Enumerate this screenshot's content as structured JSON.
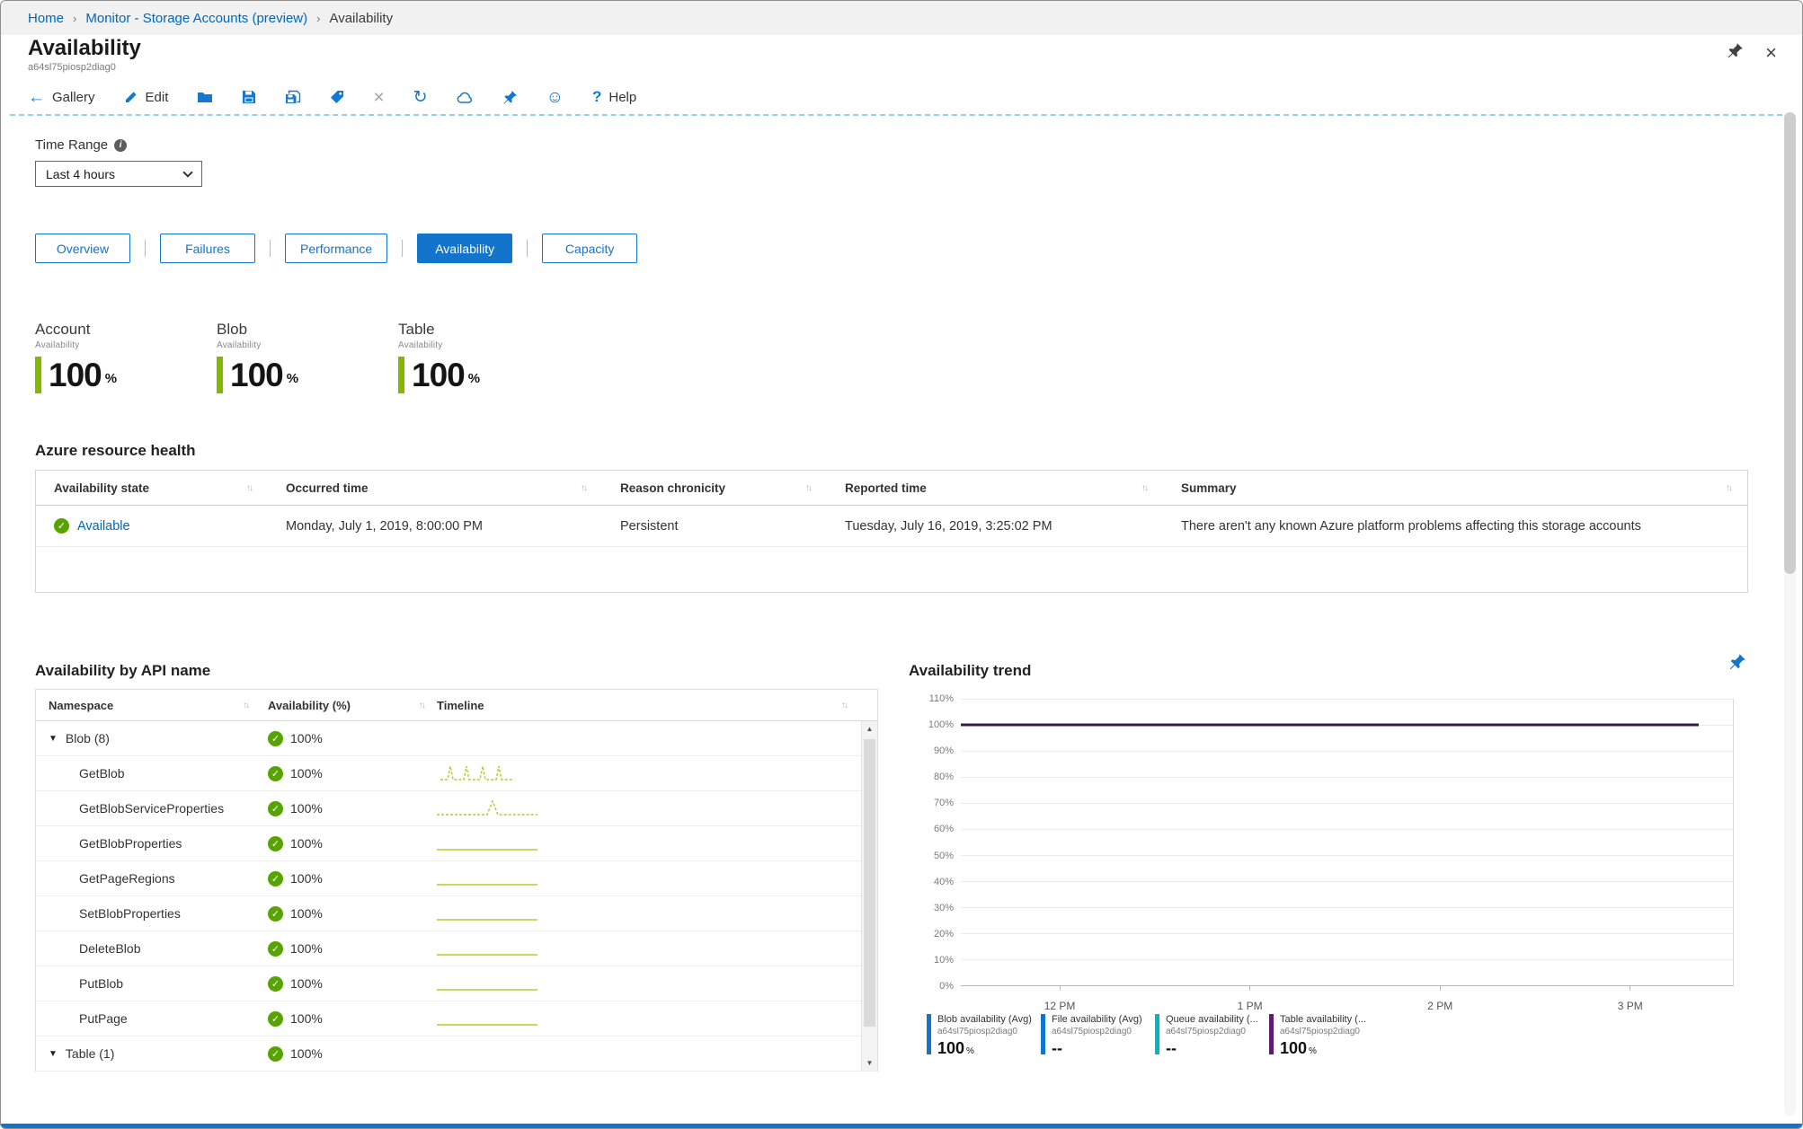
{
  "colors": {
    "accent": "#1374cc",
    "link": "#0067b8",
    "green": "#57a300",
    "tile_bar": "#7fba00",
    "sparkline": "#b5cc2e"
  },
  "icons": {
    "back": "←",
    "close": "×",
    "refresh": "↻",
    "smiley": "☺",
    "help_q": "?",
    "caret_down": "▼",
    "check": "✓",
    "sort": "↑↓",
    "scroll_up": "▲",
    "scroll_down": "▼",
    "info": "i",
    "breadcrumb_sep": "›"
  },
  "breadcrumb": {
    "items": [
      {
        "label": "Home"
      },
      {
        "label": "Monitor - Storage Accounts (preview)"
      },
      {
        "label": "Availability"
      }
    ]
  },
  "header": {
    "title": "Availability",
    "subtitle": "a64sl75piosp2diag0"
  },
  "toolbar": {
    "gallery": "Gallery",
    "edit": "Edit",
    "help": "Help"
  },
  "time_range": {
    "label": "Time Range",
    "value": "Last 4 hours"
  },
  "tabs": {
    "items": [
      {
        "label": "Overview",
        "active": false
      },
      {
        "label": "Failures",
        "active": false
      },
      {
        "label": "Performance",
        "active": false
      },
      {
        "label": "Availability",
        "active": true
      },
      {
        "label": "Capacity",
        "active": false
      }
    ]
  },
  "tiles": {
    "items": [
      {
        "title": "Account",
        "metric": "Availability",
        "value": "100",
        "unit": "%",
        "bar_color": "#7fba00"
      },
      {
        "title": "Blob",
        "metric": "Availability",
        "value": "100",
        "unit": "%",
        "bar_color": "#7fba00"
      },
      {
        "title": "Table",
        "metric": "Availability",
        "value": "100",
        "unit": "%",
        "bar_color": "#7fba00"
      }
    ]
  },
  "resource_health": {
    "title": "Azure resource health",
    "columns": [
      "Availability state",
      "Occurred time",
      "Reason chronicity",
      "Reported time",
      "Summary"
    ],
    "row": {
      "state": "Available",
      "occurred_time": "Monday, July 1, 2019, 8:00:00 PM",
      "reason_chronicity": "Persistent",
      "reported_time": "Tuesday, July 16, 2019, 3:25:02 PM",
      "summary": "There aren't any known Azure platform problems affecting this storage accounts"
    }
  },
  "api_table": {
    "title": "Availability by API name",
    "columns": [
      "Namespace",
      "Availability (%)",
      "Timeline"
    ],
    "rows": [
      {
        "name": "Blob (8)",
        "availability": "100%",
        "group": true,
        "timeline": "none"
      },
      {
        "name": "GetBlob",
        "availability": "100%",
        "group": false,
        "timeline": "peaks"
      },
      {
        "name": "GetBlobServiceProperties",
        "availability": "100%",
        "group": false,
        "timeline": "spike"
      },
      {
        "name": "GetBlobProperties",
        "availability": "100%",
        "group": false,
        "timeline": "flat"
      },
      {
        "name": "GetPageRegions",
        "availability": "100%",
        "group": false,
        "timeline": "flat"
      },
      {
        "name": "SetBlobProperties",
        "availability": "100%",
        "group": false,
        "timeline": "flat"
      },
      {
        "name": "DeleteBlob",
        "availability": "100%",
        "group": false,
        "timeline": "flat"
      },
      {
        "name": "PutBlob",
        "availability": "100%",
        "group": false,
        "timeline": "flat"
      },
      {
        "name": "PutPage",
        "availability": "100%",
        "group": false,
        "timeline": "flat"
      },
      {
        "name": "Table (1)",
        "availability": "100%",
        "group": true,
        "timeline": "none"
      }
    ]
  },
  "trend": {
    "title": "Availability trend",
    "chart_data": {
      "type": "line",
      "title": "Availability trend",
      "ylim": [
        0,
        110
      ],
      "y_ticks": [
        "110%",
        "100%",
        "90%",
        "80%",
        "70%",
        "60%",
        "50%",
        "40%",
        "30%",
        "20%",
        "10%",
        "0%"
      ],
      "x_ticks": [
        "12 PM",
        "1 PM",
        "2 PM",
        "3 PM"
      ],
      "grid": true,
      "legend_position": "bottom",
      "plotted_line": {
        "value": 100,
        "color": "#38184f"
      },
      "series": [
        {
          "name": "Blob availability (Avg)",
          "resource": "a64sl75piosp2diag0",
          "value": "100",
          "unit": "%",
          "color": "#1374cc",
          "y": 100
        },
        {
          "name": "File availability (Avg)",
          "resource": "a64sl75piosp2diag0",
          "value": "--",
          "unit": "",
          "color": "#1374cc",
          "y": null
        },
        {
          "name": "Queue availability (...",
          "resource": "a64sl75piosp2diag0",
          "value": "--",
          "unit": "",
          "color": "#00b7c3",
          "y": null
        },
        {
          "name": "Table availability (...",
          "resource": "a64sl75piosp2diag0",
          "value": "100",
          "unit": "%",
          "color": "#5c1d6e",
          "y": 100
        }
      ]
    }
  }
}
